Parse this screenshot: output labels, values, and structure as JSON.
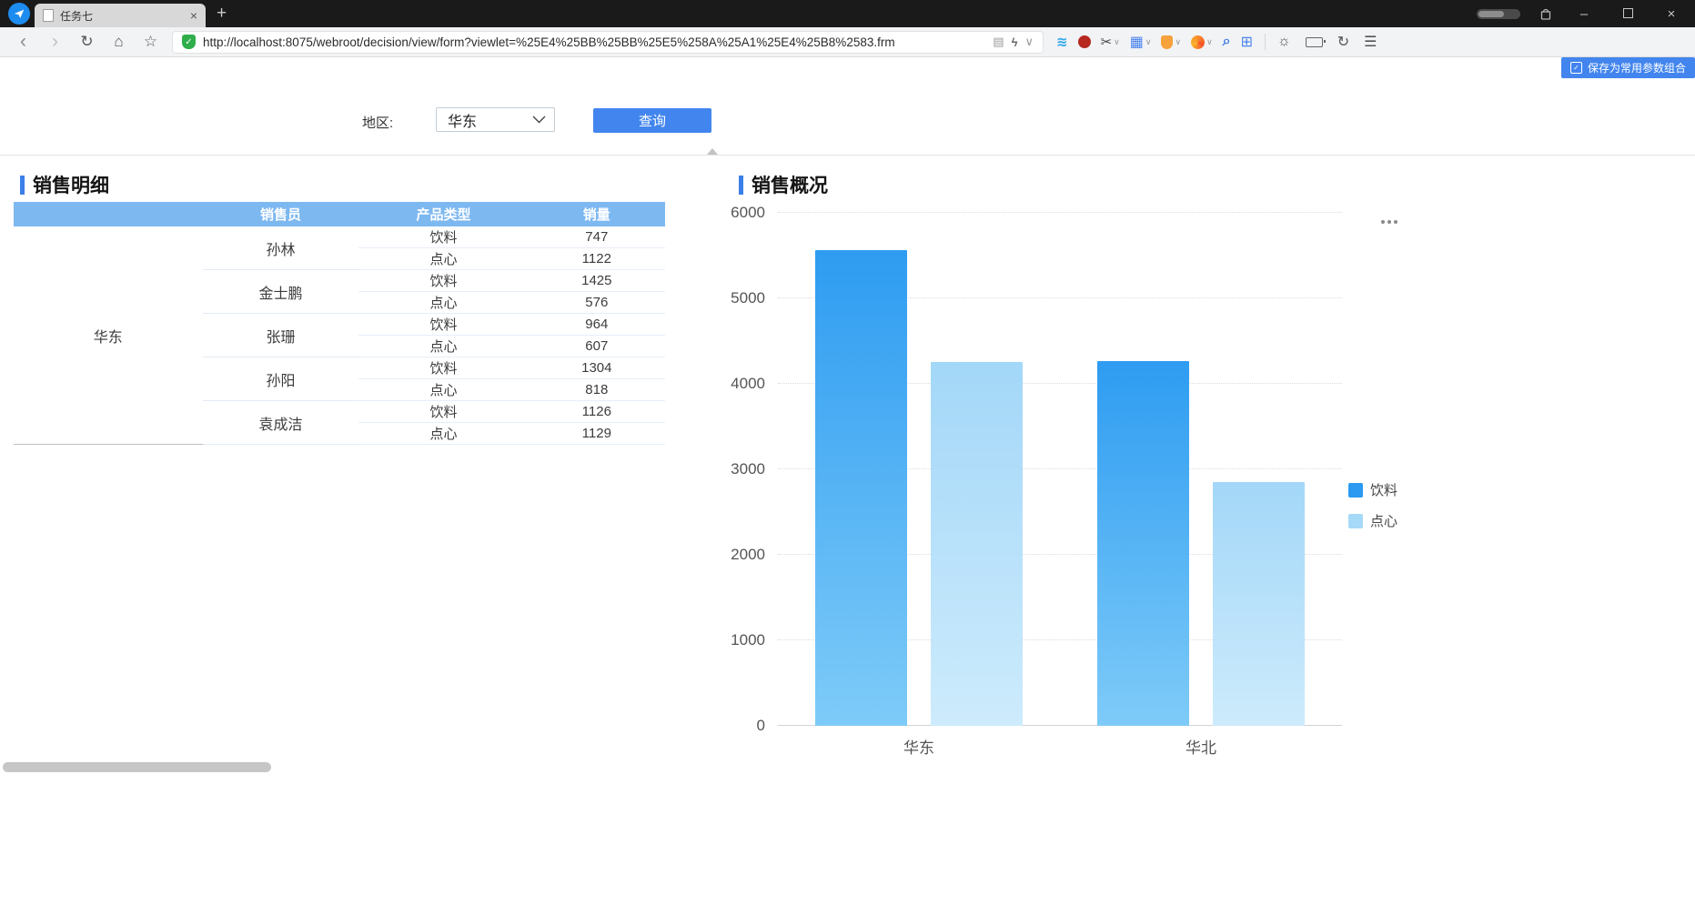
{
  "browser": {
    "tab_title": "任务七",
    "url": "http://localhost:8075/webroot/decision/view/form?viewlet=%25E4%25BB%25BB%25E5%258A%25A1%25E4%25B8%2583.frm"
  },
  "icons": {
    "back": "‹",
    "forward": "›",
    "refresh": "↻",
    "home": "⌂",
    "favorite": "☆",
    "reader": "▤",
    "flash": "ϟ",
    "caret": "∨",
    "wave": "≋",
    "scissors": "✂",
    "grid_ext": "▦",
    "magnifier": "⌕",
    "apps": "⊞",
    "brightness": "☼",
    "sync": "↻",
    "menu": "☰",
    "new_tab": "+",
    "close": "×",
    "minimize": "–",
    "shield_check": "✓",
    "save_check": "✓"
  },
  "toolbar": {
    "save_param_label": "保存为常用参数组合"
  },
  "form": {
    "region_label": "地区:",
    "region_value": "华东",
    "query_label": "查询"
  },
  "detail": {
    "title": "销售明细",
    "columns": [
      "销售员",
      "产品类型",
      "销量"
    ],
    "region": "华东",
    "groups": [
      {
        "salesperson": "孙林",
        "rows": [
          [
            "饮料",
            "747"
          ],
          [
            "点心",
            "1122"
          ]
        ]
      },
      {
        "salesperson": "金士鹏",
        "rows": [
          [
            "饮料",
            "1425"
          ],
          [
            "点心",
            "576"
          ]
        ]
      },
      {
        "salesperson": "张珊",
        "rows": [
          [
            "饮料",
            "964"
          ],
          [
            "点心",
            "607"
          ]
        ]
      },
      {
        "salesperson": "孙阳",
        "rows": [
          [
            "饮料",
            "1304"
          ],
          [
            "点心",
            "818"
          ]
        ]
      },
      {
        "salesperson": "袁成洁",
        "rows": [
          [
            "饮料",
            "1126"
          ],
          [
            "点心",
            "1129"
          ]
        ]
      }
    ]
  },
  "overview": {
    "title": "销售概况"
  },
  "chart_data": {
    "type": "bar",
    "title": "销售概况",
    "categories": [
      "华东",
      "华北"
    ],
    "series": [
      {
        "name": "饮料",
        "values": [
          5566,
          4270
        ],
        "color": "#2b9af0",
        "color_top": "#2e9cf1",
        "color_bottom": "#7ecbf8"
      },
      {
        "name": "点心",
        "values": [
          4252,
          2850
        ],
        "color": "#a6d9f8",
        "color_top": "#a3d7f8",
        "color_bottom": "#cdebfc"
      }
    ],
    "xlabel": "",
    "ylabel": "",
    "ylim": [
      0,
      6000
    ],
    "yticks": [
      0,
      1000,
      2000,
      3000,
      4000,
      5000,
      6000
    ],
    "grid": true,
    "legend_position": "right"
  }
}
